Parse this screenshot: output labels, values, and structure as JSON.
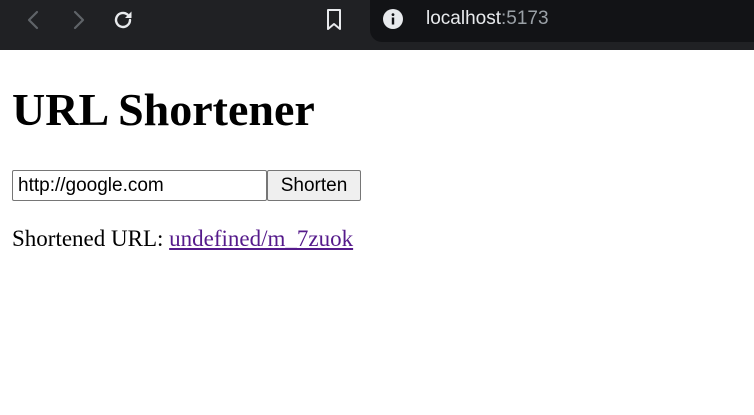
{
  "browser": {
    "url_host": "localhost",
    "url_port": ":5173",
    "icons": [
      "back-icon",
      "forward-icon",
      "reload-icon",
      "bookmark-icon",
      "info-icon"
    ]
  },
  "page": {
    "title": "URL Shortener",
    "input": {
      "value": "http://google.com",
      "placeholder": ""
    },
    "shorten_label": "Shorten",
    "result_label": "Shortened URL: ",
    "result_link": "undefined/m_7zuok"
  },
  "colors": {
    "toolbar_bg": "#202124",
    "link_visited": "#551a8b"
  }
}
